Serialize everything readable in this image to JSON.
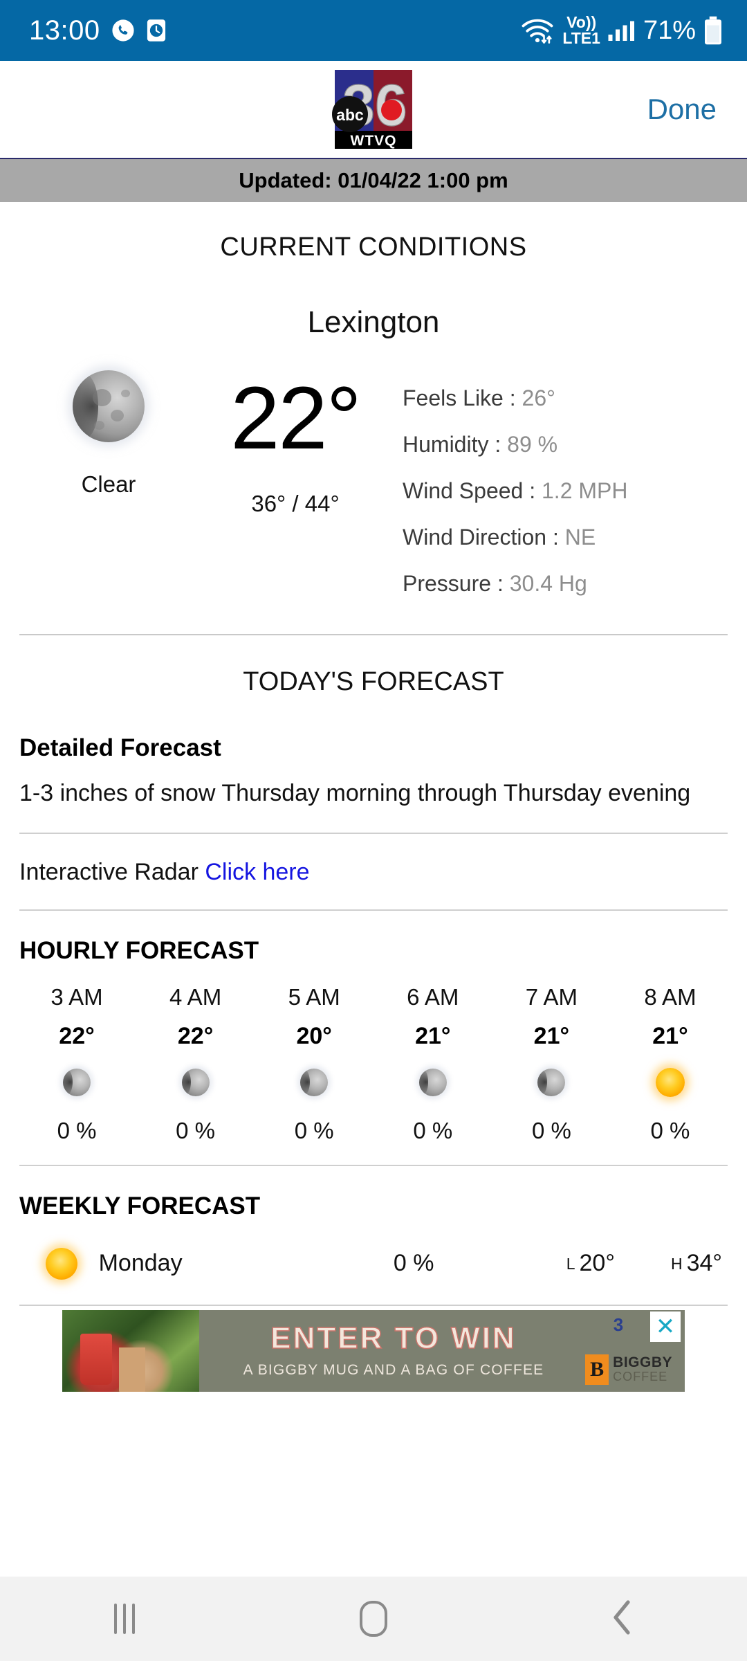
{
  "status_bar": {
    "time": "13:00",
    "icons": [
      "whatsapp-icon",
      "clock-icon"
    ],
    "network_label": "Vo))",
    "network_type": "LTE1",
    "battery_percent": "71%"
  },
  "header": {
    "logo_alt": "abc 36 WTVQ",
    "logo_number": "36",
    "logo_abc": "abc",
    "logo_callsign": "WTVQ",
    "done_label": "Done"
  },
  "updated": {
    "text": "Updated: 01/04/22 1:00 pm"
  },
  "current_conditions": {
    "heading": "CURRENT CONDITIONS",
    "city": "Lexington",
    "condition": "Clear",
    "condition_icon": "moon-icon",
    "temperature": "22°",
    "temp_range": "36° / 44°",
    "details": [
      {
        "label": "Feels Like :",
        "value": "26°"
      },
      {
        "label": "Humidity :",
        "value": "89 %"
      },
      {
        "label": "Wind Speed :",
        "value": "1.2 MPH"
      },
      {
        "label": "Wind Direction :",
        "value": "NE"
      },
      {
        "label": "Pressure :",
        "value": "30.4 Hg"
      }
    ]
  },
  "todays_forecast": {
    "heading": "TODAY'S FORECAST",
    "detailed_label": "Detailed Forecast",
    "detailed_text": "1-3 inches of snow Thursday morning through Thursday evening",
    "radar_label": "Interactive Radar",
    "radar_link": "Click here"
  },
  "hourly_forecast": {
    "heading": "HOURLY FORECAST",
    "items": [
      {
        "time": "3 AM",
        "temp": "22°",
        "icon": "moon-icon",
        "pop": "0 %"
      },
      {
        "time": "4 AM",
        "temp": "22°",
        "icon": "moon-icon",
        "pop": "0 %"
      },
      {
        "time": "5 AM",
        "temp": "20°",
        "icon": "moon-icon",
        "pop": "0 %"
      },
      {
        "time": "6 AM",
        "temp": "21°",
        "icon": "moon-icon",
        "pop": "0 %"
      },
      {
        "time": "7 AM",
        "temp": "21°",
        "icon": "moon-icon",
        "pop": "0 %"
      },
      {
        "time": "8 AM",
        "temp": "21°",
        "icon": "sun-icon",
        "pop": "0 %"
      }
    ]
  },
  "weekly_forecast": {
    "heading": "WEEKLY FORECAST",
    "low_prefix": "L",
    "high_prefix": "H",
    "days": [
      {
        "icon": "sun-icon",
        "day": "Monday",
        "pop": "0 %",
        "low": "20°",
        "high": "34°"
      }
    ]
  },
  "advertisement": {
    "title": "ENTER TO WIN",
    "subtitle": "A BIGGBY MUG AND A BAG OF COFFEE",
    "brand_mark": "B",
    "brand_line1": "BIGGBY",
    "brand_line2": "COFFEE",
    "badge": "3",
    "close_label": "✕"
  },
  "nav_bar": {
    "recents": "recents-button",
    "home": "home-button",
    "back": "back-button"
  },
  "colors": {
    "status_bar": "#0568a5",
    "done_link": "#1d6fa5",
    "updated_bar": "#a8a8a8",
    "radar_link": "#1414e0"
  }
}
